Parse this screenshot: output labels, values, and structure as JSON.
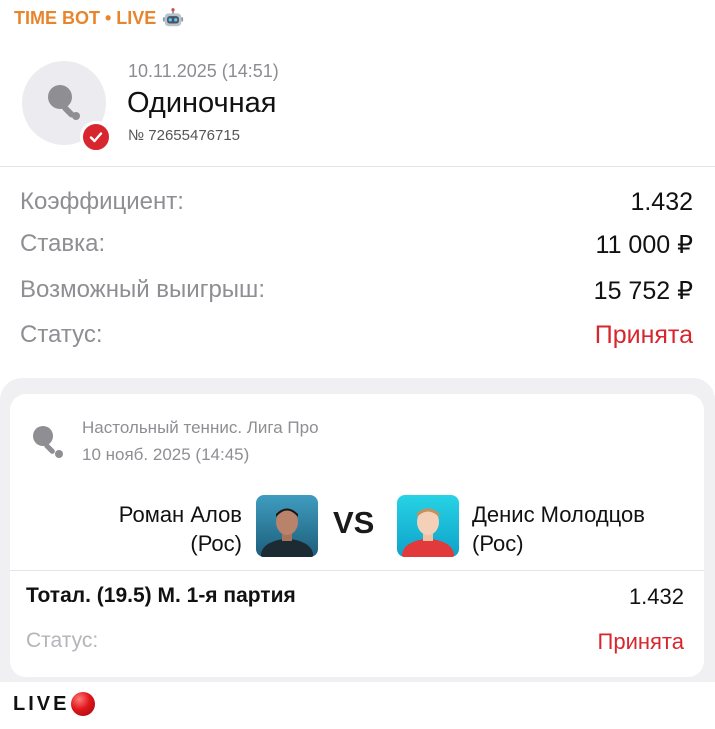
{
  "channel": {
    "title": "TIME BOT • LIVE",
    "icon": "robot-icon",
    "accent": "#e8852c"
  },
  "bet": {
    "date": "10.11.2025 (14:51)",
    "type": "Одиночная",
    "number": "№ 72655476715",
    "icon": "table-tennis-icon",
    "status_color": "#d8262e"
  },
  "summary": {
    "rows": [
      {
        "label": "Коэффициент:",
        "value": "1.432"
      },
      {
        "label": "Ставка:",
        "value": "11 000 ₽"
      },
      {
        "label": "Возможный выигрыш:",
        "value": "15 752 ₽"
      },
      {
        "label": "Статус:",
        "value": "Принята"
      }
    ]
  },
  "event": {
    "league": "Настольный теннис. Лига Про",
    "date": "10 нояб. 2025 (14:45)",
    "player1": {
      "name": "Роман Алов",
      "country": "(Рос)"
    },
    "player2": {
      "name": "Денис Молодцов",
      "country": "(Рос)"
    },
    "vs": "VS",
    "market": "Тотал. (19.5) М. 1-я партия",
    "odds": "1.432",
    "status_label": "Статус:",
    "status_value": "Принята"
  },
  "footer": {
    "text": "LIVE",
    "icon": "red-circle-icon"
  }
}
